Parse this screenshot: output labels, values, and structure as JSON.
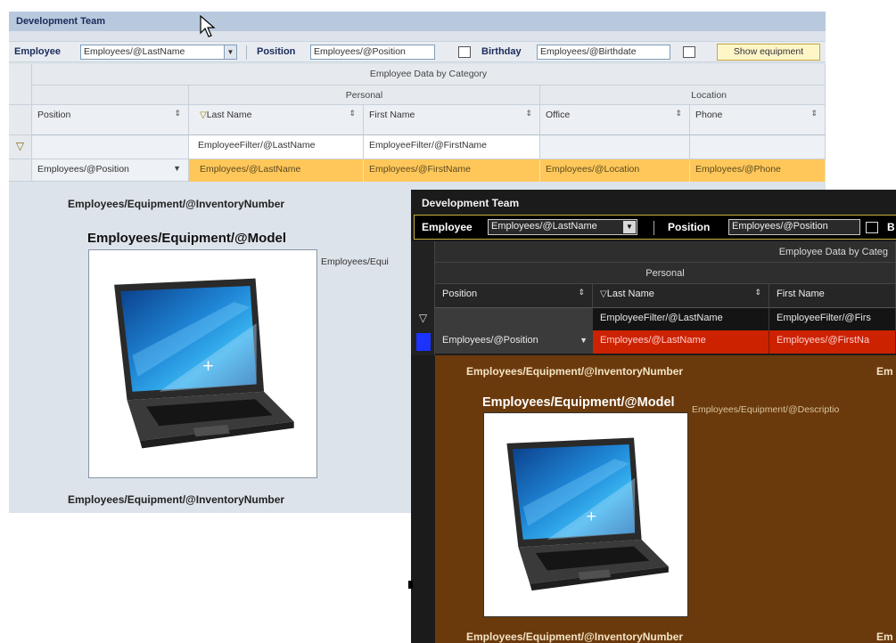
{
  "light": {
    "title": "Development Team",
    "toolbar": {
      "employee_label": "Employee",
      "employee_value": "Employees/@LastName",
      "position_label": "Position",
      "position_value": "Employees/@Position",
      "birthday_label": "Birthday",
      "birthday_value": "Employees/@Birthdate",
      "show_equipment_label": "Show equipment"
    },
    "grid": {
      "band_title": "Employee Data by Category",
      "groups": [
        "Personal",
        "Location"
      ],
      "columns": [
        "Position",
        "Last Name",
        "First Name",
        "Office",
        "Phone"
      ],
      "filter_row": [
        "",
        "EmployeeFilter/@LastName",
        "EmployeeFilter/@FirstName",
        "",
        ""
      ],
      "data_row": [
        "Employees/@Position",
        "Employees/@LastName",
        "Employees/@FirstName",
        "Employees/@Location",
        "Employees/@Phone"
      ]
    },
    "detail": {
      "inventory_top": "Employees/Equipment/@InventoryNumber",
      "model": "Employees/Equipment/@Model",
      "description_fragment": "Employees/Equi",
      "inventory_bottom": "Employees/Equipment/@InventoryNumber"
    }
  },
  "dark": {
    "title": "Development Team",
    "toolbar": {
      "employee_label": "Employee",
      "employee_value": "Employees/@LastName",
      "position_label": "Position",
      "position_value": "Employees/@Position",
      "birthday_fragment": "B"
    },
    "grid": {
      "band_title": "Employee Data by Categ",
      "group": "Personal",
      "columns": [
        "Position",
        "Last Name",
        "First Name"
      ],
      "filter_row": [
        "",
        "EmployeeFilter/@LastName",
        "EmployeeFilter/@Firs"
      ],
      "data_row": [
        "Employees/@Position",
        "Employees/@LastName",
        "Employees/@FirstNa"
      ]
    },
    "detail": {
      "inventory_top": "Employees/Equipment/@InventoryNumber",
      "inventory_top_right": "Em",
      "model": "Employees/Equipment/@Model",
      "description": "Employees/Equipment/@Descriptio",
      "inventory_bottom": "Employees/Equipment/@InventoryNumber",
      "inventory_bottom_right": "Em"
    }
  },
  "icons": [
    "mouse-cursor-icon",
    "filter-icon",
    "sort-icon",
    "calendar-icon",
    "dropdown-arrow-icon",
    "laptop-image"
  ],
  "colors": {
    "light_title_bar": "#b8c9de",
    "light_selected_row": "#ffc75a",
    "show_equipment_button": "#fff6c8",
    "dark_selected_cell": "#cc2200",
    "dark_detail_bg": "#6b3a0c",
    "dark_row_marker": "#1a33ff"
  }
}
